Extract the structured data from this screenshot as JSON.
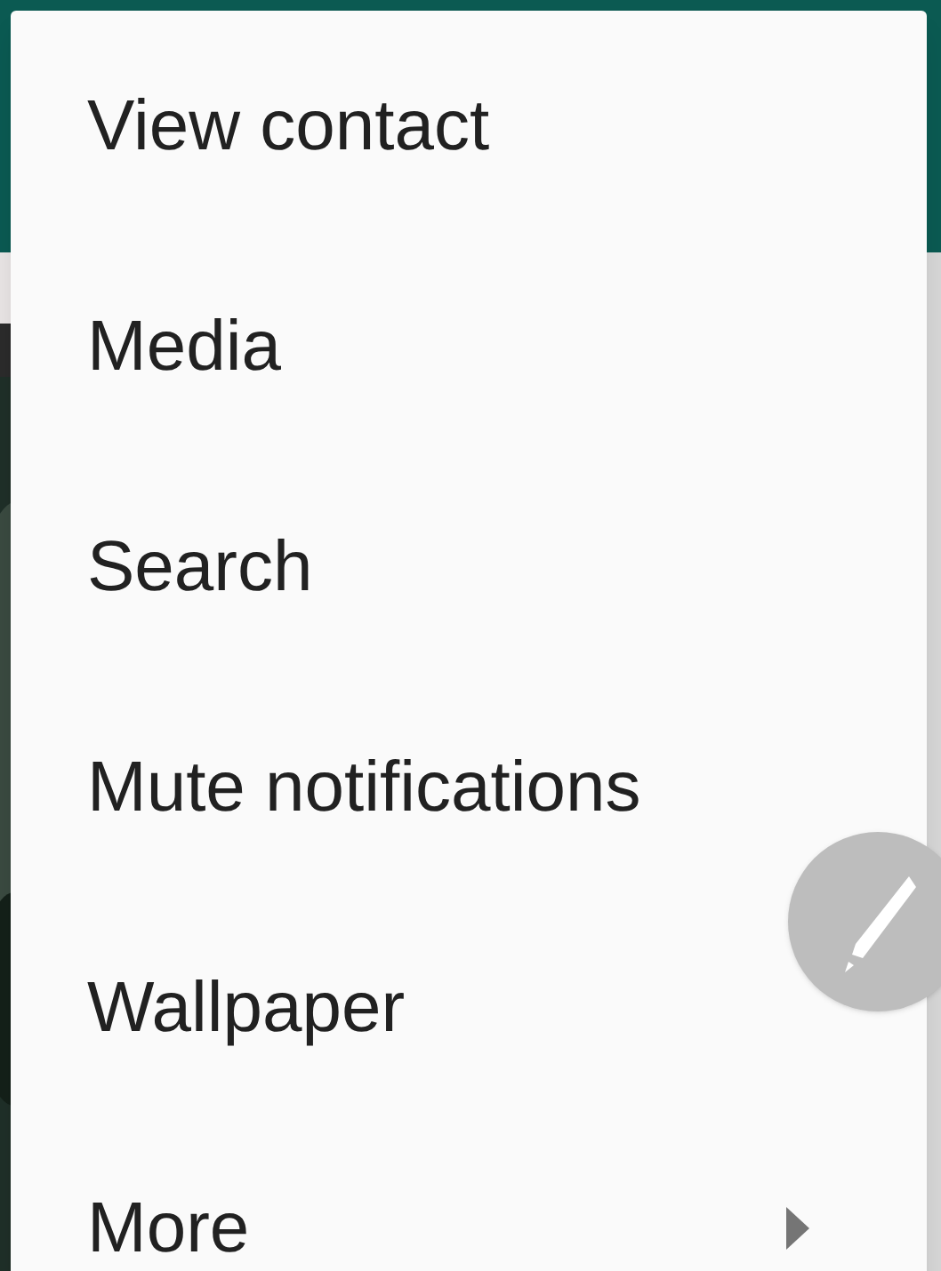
{
  "menu": {
    "items": [
      {
        "label": "View contact",
        "kind": "plain"
      },
      {
        "label": "Media",
        "kind": "plain"
      },
      {
        "label": "Search",
        "kind": "plain"
      },
      {
        "label": "Mute notifications",
        "kind": "plain"
      },
      {
        "label": "Wallpaper",
        "kind": "plain"
      },
      {
        "label": "More",
        "kind": "submenu"
      }
    ]
  }
}
